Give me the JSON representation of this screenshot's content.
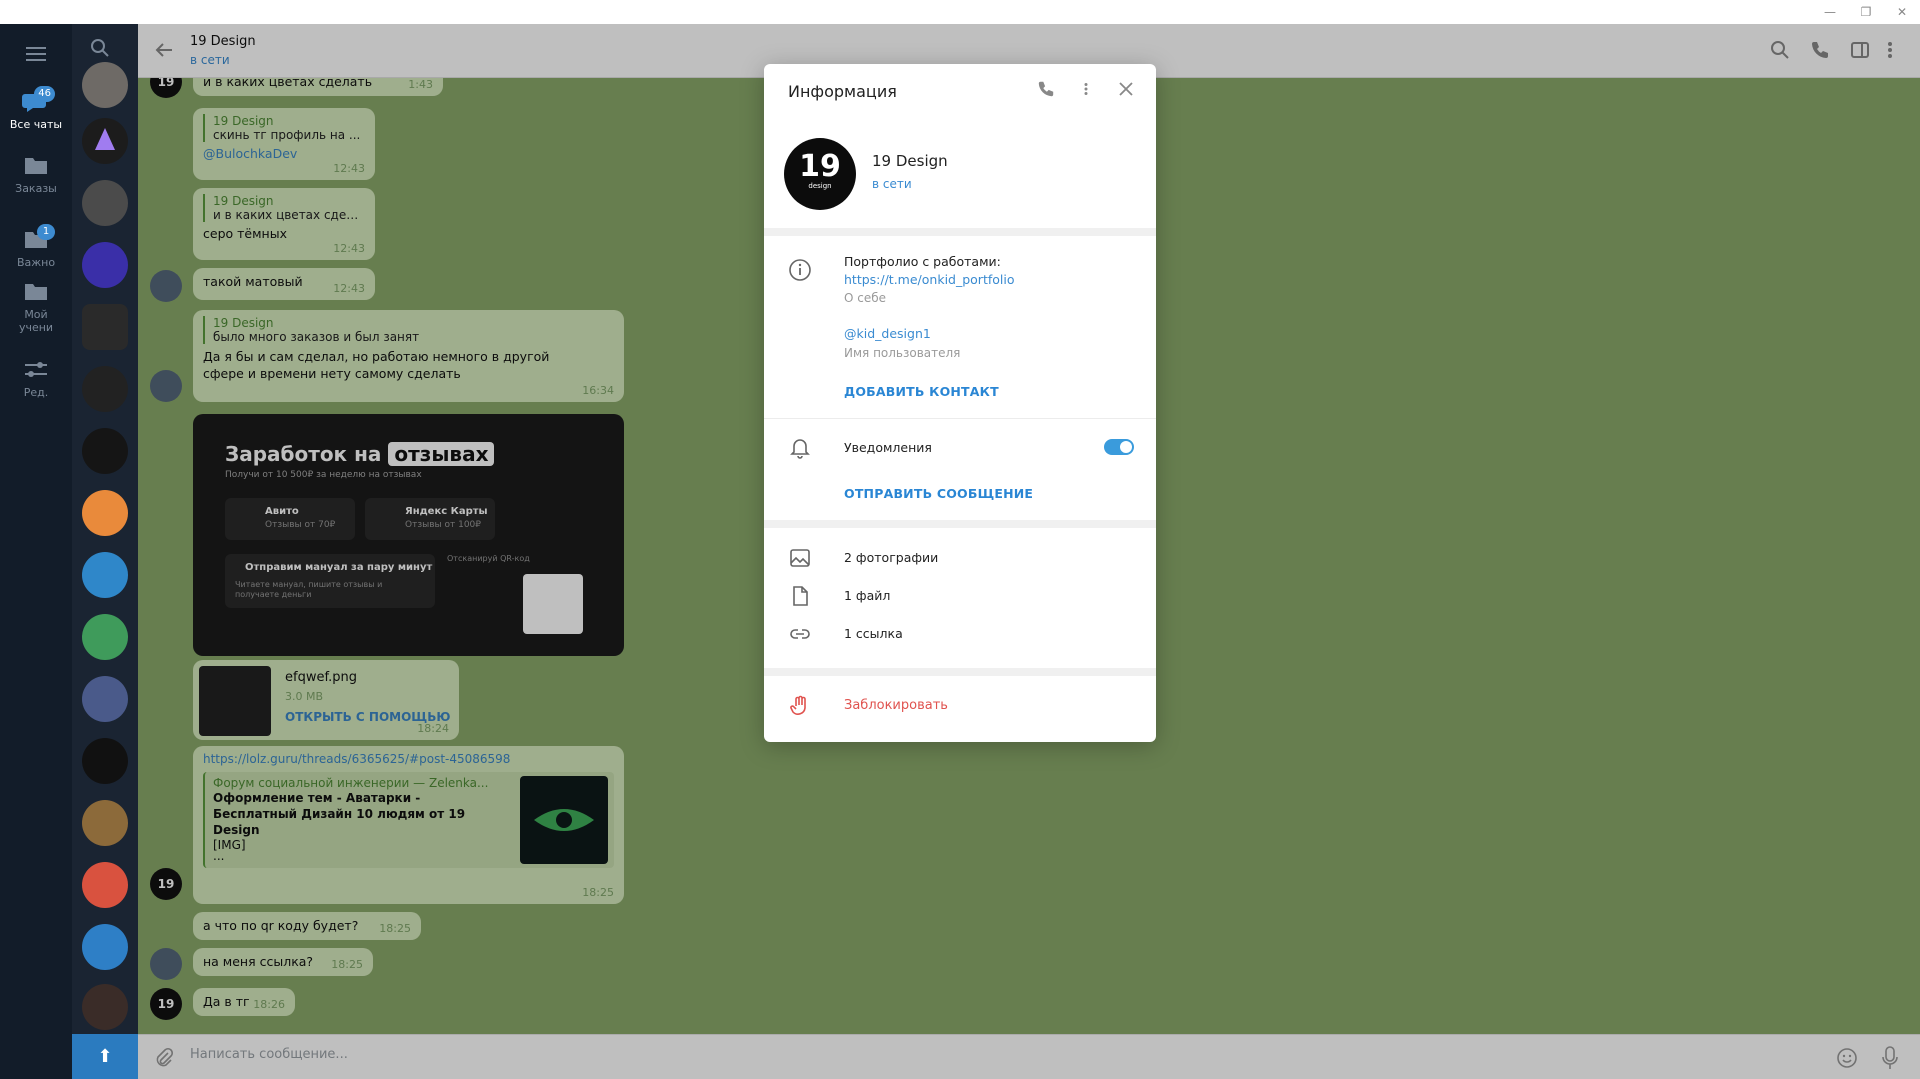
{
  "window": {
    "minimize": "—",
    "restore": "❐",
    "close": "✕"
  },
  "folders": [
    {
      "label": "Все чаты",
      "badge": "46"
    },
    {
      "label": "Заказы"
    },
    {
      "label": "Важно",
      "badge": "1"
    },
    {
      "label": "Мой учени"
    },
    {
      "label": "Ред."
    }
  ],
  "chat": {
    "title": "19 Design",
    "status": "в сети"
  },
  "messages": [
    {
      "text": "и в каких цветах сделать",
      "time": "1:43"
    },
    {
      "reply_name": "19 Design",
      "reply_text": "скинь тг профиль на ...",
      "text": "@BulochkaDev",
      "time": "12:43"
    },
    {
      "reply_name": "19 Design",
      "reply_text": "и в каких цветах сдел...",
      "text": "серо тёмных",
      "time": "12:43"
    },
    {
      "text": "такой матовый",
      "time": "12:43"
    },
    {
      "reply_name": "19 Design",
      "reply_text": "было много заказов и был занят",
      "text": "Да я бы и сам сделал, но работаю немного в другой сфере и времени нету самому сделать",
      "time": "16:34"
    }
  ],
  "promo": {
    "title_a": "Заработок на",
    "title_b": "отзывах",
    "subtitle": "Получи от 10 500₽ за неделю на отзывах",
    "card1_title": "Авито",
    "card1_sub": "Отзывы от 70₽",
    "card2_title": "Яндекс Карты",
    "card2_sub": "Отзывы от 100₽",
    "card3_title": "Отправим мануал за пару минут",
    "card3_sub": "Читаете мануал, пишите отзывы и получаете деньги",
    "qr_label": "Отсканируй QR-код"
  },
  "file": {
    "name": "efqwef.png",
    "size": "3.0 MB",
    "action": "ОТКРЫТЬ С ПОМОЩЬЮ",
    "time": "18:24"
  },
  "link_message": {
    "url": "https://lolz.guru/threads/6365625/#post-45086598",
    "site": "Форум социальной инженерии — Zelenka...",
    "title": "Оформление тем - Аватарки - Бесплатный Дизайн 10 людям от 19 Design",
    "extra": "[IMG]",
    "dots": "...",
    "time": "18:25"
  },
  "messages2": [
    {
      "text": "а что по qr коду будет?",
      "time": "18:25"
    },
    {
      "text": "на меня ссылка?",
      "time": "18:25"
    },
    {
      "text": "Да в тг",
      "time": "18:26"
    }
  ],
  "composer": {
    "placeholder": "Написать сообщение..."
  },
  "info": {
    "title": "Информация",
    "name": "19 Design",
    "status": "в сети",
    "avatar_text": "19",
    "avatar_sub": "design",
    "bio": "Портфолио с работами:",
    "bio_link": "https://t.me/onkid_portfolio",
    "bio_label": "О себе",
    "username": "@kid_design1",
    "username_label": "Имя пользователя",
    "add_contact": "ДОБАВИТЬ КОНТАКТ",
    "notifications": "Уведомления",
    "notifications_on": true,
    "send_message": "ОТПРАВИТЬ СООБЩЕНИЕ",
    "photos": "2 фотографии",
    "files": "1 файл",
    "links": "1 ссылка",
    "block": "Заблокировать"
  },
  "colors": {
    "accent": "#3a8bd1",
    "danger": "#e0534f",
    "sidebar": "#121c29",
    "bubble": "#d5e8bd"
  }
}
